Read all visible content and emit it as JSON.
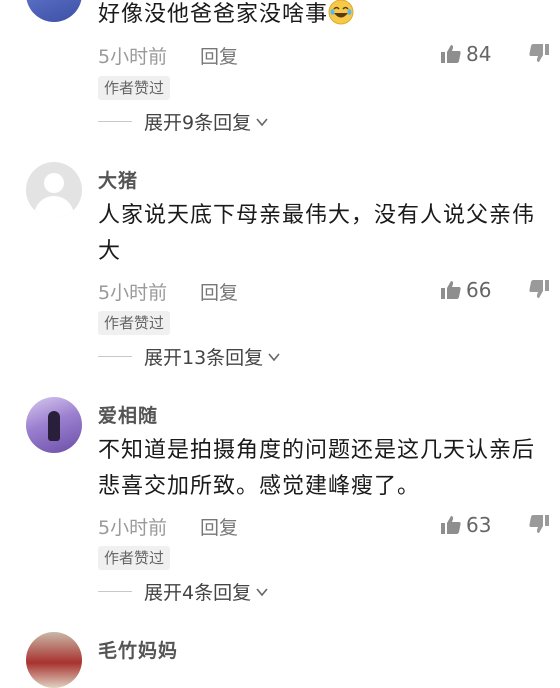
{
  "comments": [
    {
      "username": "",
      "text": "好像没他爸爸家没啥事",
      "time": "5小时前",
      "reply_label": "回复",
      "likes": "84",
      "badge": "作者赞过",
      "expand_label": "展开9条回复"
    },
    {
      "username": "大猪",
      "text": "人家说天底下母亲最伟大，没有人说父亲伟大",
      "time": "5小时前",
      "reply_label": "回复",
      "likes": "66",
      "badge": "作者赞过",
      "expand_label": "展开13条回复"
    },
    {
      "username": "爱相随",
      "text": "不知道是拍摄角度的问题还是这几天认亲后悲喜交加所致。感觉建峰瘦了。",
      "time": "5小时前",
      "reply_label": "回复",
      "likes": "63",
      "badge": "作者赞过",
      "expand_label": "展开4条回复"
    },
    {
      "username": "毛竹妈妈"
    }
  ],
  "icons": {
    "like": "thumbs-up-icon",
    "dislike": "thumbs-down-icon",
    "expand": "chevron-down-icon",
    "emoji": "laughing-tears-emoji"
  },
  "colors": {
    "text": "#1a1a1a",
    "meta": "#9a9a9a",
    "badge_bg": "#f0f0f0"
  }
}
